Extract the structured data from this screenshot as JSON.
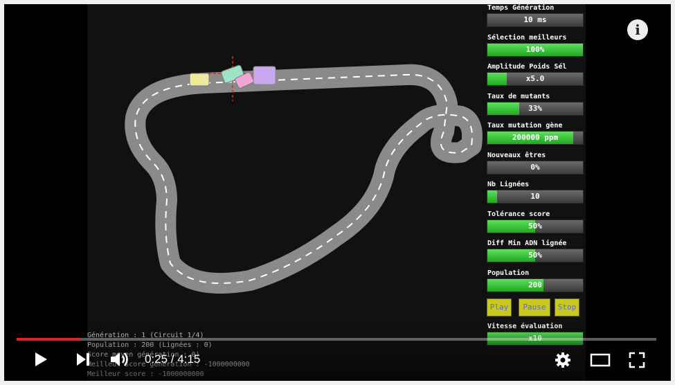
{
  "panel": {
    "controls": [
      {
        "label": "Temps Génération",
        "value": "10 ms",
        "level": 0
      },
      {
        "label": "Sélection meilleurs",
        "value": "100%",
        "level": 1.0
      },
      {
        "label": "Amplitude Poids Sél",
        "value": "x5.0",
        "level": 0.2
      },
      {
        "label": "Taux de mutants",
        "value": "33%",
        "level": 0.33
      },
      {
        "label": "Taux mutation gène",
        "value": "200000 ppm",
        "level": 0.9
      },
      {
        "label": "Nouveaux êtres",
        "value": "0%",
        "level": 0
      },
      {
        "label": "Nb Lignées",
        "value": "10",
        "level": 0.1
      },
      {
        "label": "Tolérance score",
        "value": "50%",
        "level": 0.5
      },
      {
        "label": "Diff Min ADN lignée",
        "value": "50%",
        "level": 0.5
      },
      {
        "label": "Population",
        "value": "200",
        "level": 0.59
      }
    ],
    "buttons": {
      "play": "Play",
      "pause": "Pause",
      "stop": "Stop"
    },
    "eval_speed": {
      "label": "Vitesse évaluation",
      "value": "x10",
      "level": 1.0
    }
  },
  "stats": [
    "Génération : 1 (Circuit 1/4)",
    "Population : 200 (Lignées : 0)",
    "Score moyen génération : 0)",
    "Meilleur score génération : -1000000000",
    "Meilleur score : -1000000000"
  ],
  "player": {
    "current_time": "0:25",
    "separator": " / ",
    "duration": "4:15",
    "progress_fraction": 0.098,
    "icons": [
      "play-icon",
      "next-icon",
      "volume-icon",
      "settings-icon",
      "theater-icon",
      "fullscreen-icon",
      "info-icon"
    ],
    "accent_color": "#e02020"
  }
}
